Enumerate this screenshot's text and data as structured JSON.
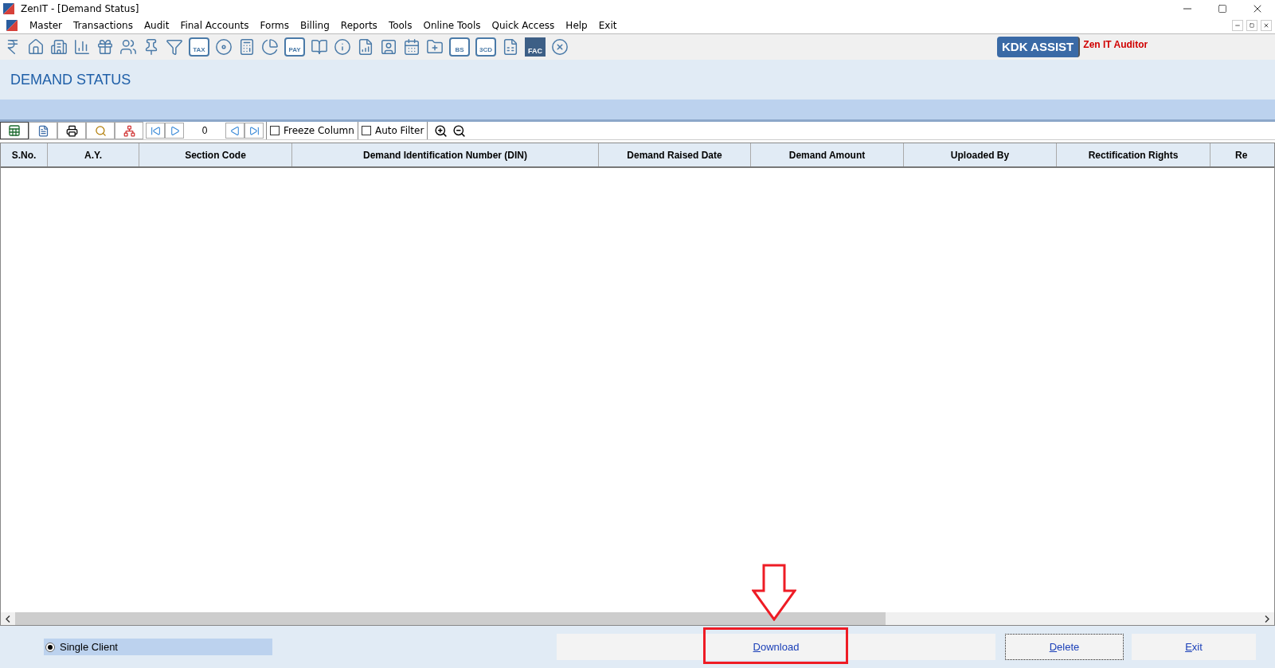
{
  "window": {
    "title": "ZenIT - [Demand Status]"
  },
  "menu": [
    "Master",
    "Transactions",
    "Audit",
    "Final Accounts",
    "Forms",
    "Billing",
    "Reports",
    "Tools",
    "Online Tools",
    "Quick Access",
    "Help",
    "Exit"
  ],
  "toolbar": [
    {
      "kind": "rupee"
    },
    {
      "kind": "home"
    },
    {
      "kind": "building"
    },
    {
      "kind": "chart"
    },
    {
      "kind": "gift"
    },
    {
      "kind": "users"
    },
    {
      "kind": "pin"
    },
    {
      "kind": "filter"
    },
    {
      "kind": "tag",
      "label": "TAX"
    },
    {
      "kind": "disc"
    },
    {
      "kind": "calculator"
    },
    {
      "kind": "pie"
    },
    {
      "kind": "badge",
      "label": "PAY"
    },
    {
      "kind": "book"
    },
    {
      "kind": "info"
    },
    {
      "kind": "report"
    },
    {
      "kind": "person"
    },
    {
      "kind": "calendar"
    },
    {
      "kind": "folder"
    },
    {
      "kind": "box",
      "label": "BS"
    },
    {
      "kind": "box",
      "label": "3CD"
    },
    {
      "kind": "sheet"
    },
    {
      "kind": "dark",
      "label": "FAC"
    },
    {
      "kind": "close"
    }
  ],
  "kdk_assist": "KDK ASSIST",
  "product": "Zen IT Auditor",
  "page_title": "DEMAND STATUS",
  "grid_toolbar": {
    "record": "0",
    "freeze_column": {
      "label": "Freeze Column",
      "checked": false
    },
    "auto_filter": {
      "label": "Auto Filter",
      "checked": false
    }
  },
  "table": {
    "columns": [
      "S.No.",
      "A.Y.",
      "Section Code",
      "Demand Identification Number (DIN)",
      "Demand Raised Date",
      "Demand Amount",
      "Uploaded By",
      "Rectification Rights",
      "Re"
    ]
  },
  "options": [
    {
      "label": "Single Client",
      "selected": true
    }
  ],
  "buttons": [
    {
      "label": "Download",
      "focused": false,
      "highlighted": true
    },
    {
      "label": "Delete",
      "focused": true,
      "highlighted": false
    },
    {
      "label": "Exit",
      "focused": false,
      "highlighted": false
    }
  ]
}
